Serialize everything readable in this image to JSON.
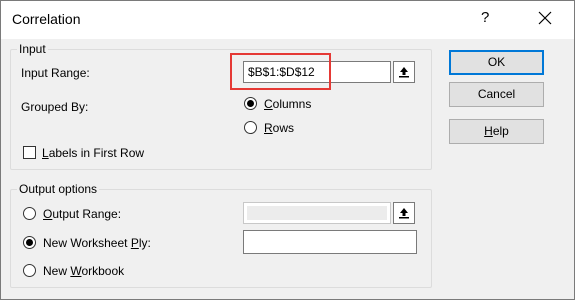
{
  "window": {
    "title": "Correlation",
    "help_glyph": "?"
  },
  "input_group": {
    "title": "Input",
    "input_range_label": "Input Range:",
    "input_range_value": "$B$1:$D$12",
    "grouped_by_label": "Grouped By:",
    "columns_label_u": "C",
    "columns_label_rest": "olumns",
    "rows_label_u": "R",
    "rows_label_rest": "ows",
    "grouped_by_selected": "Columns",
    "labels_first_row_u": "L",
    "labels_first_row_rest": "abels in First Row",
    "labels_first_row_checked": false
  },
  "output_group": {
    "title": "Output options",
    "output_range_u": "O",
    "output_range_rest": "utput Range:",
    "output_range_value": "",
    "new_worksheet_pre": "New Worksheet ",
    "new_worksheet_u": "P",
    "new_worksheet_post": "ly:",
    "new_worksheet_value": "",
    "new_workbook_pre": "New ",
    "new_workbook_u": "W",
    "new_workbook_post": "orkbook",
    "selected": "New Worksheet Ply"
  },
  "buttons": {
    "ok": "OK",
    "cancel": "Cancel",
    "help_u": "H",
    "help_rest": "elp"
  },
  "colors": {
    "highlight": "#e53935",
    "default_button_border": "#0078d7"
  },
  "icons": {
    "collapse": "collapse-dialog-icon",
    "close": "close-icon"
  }
}
